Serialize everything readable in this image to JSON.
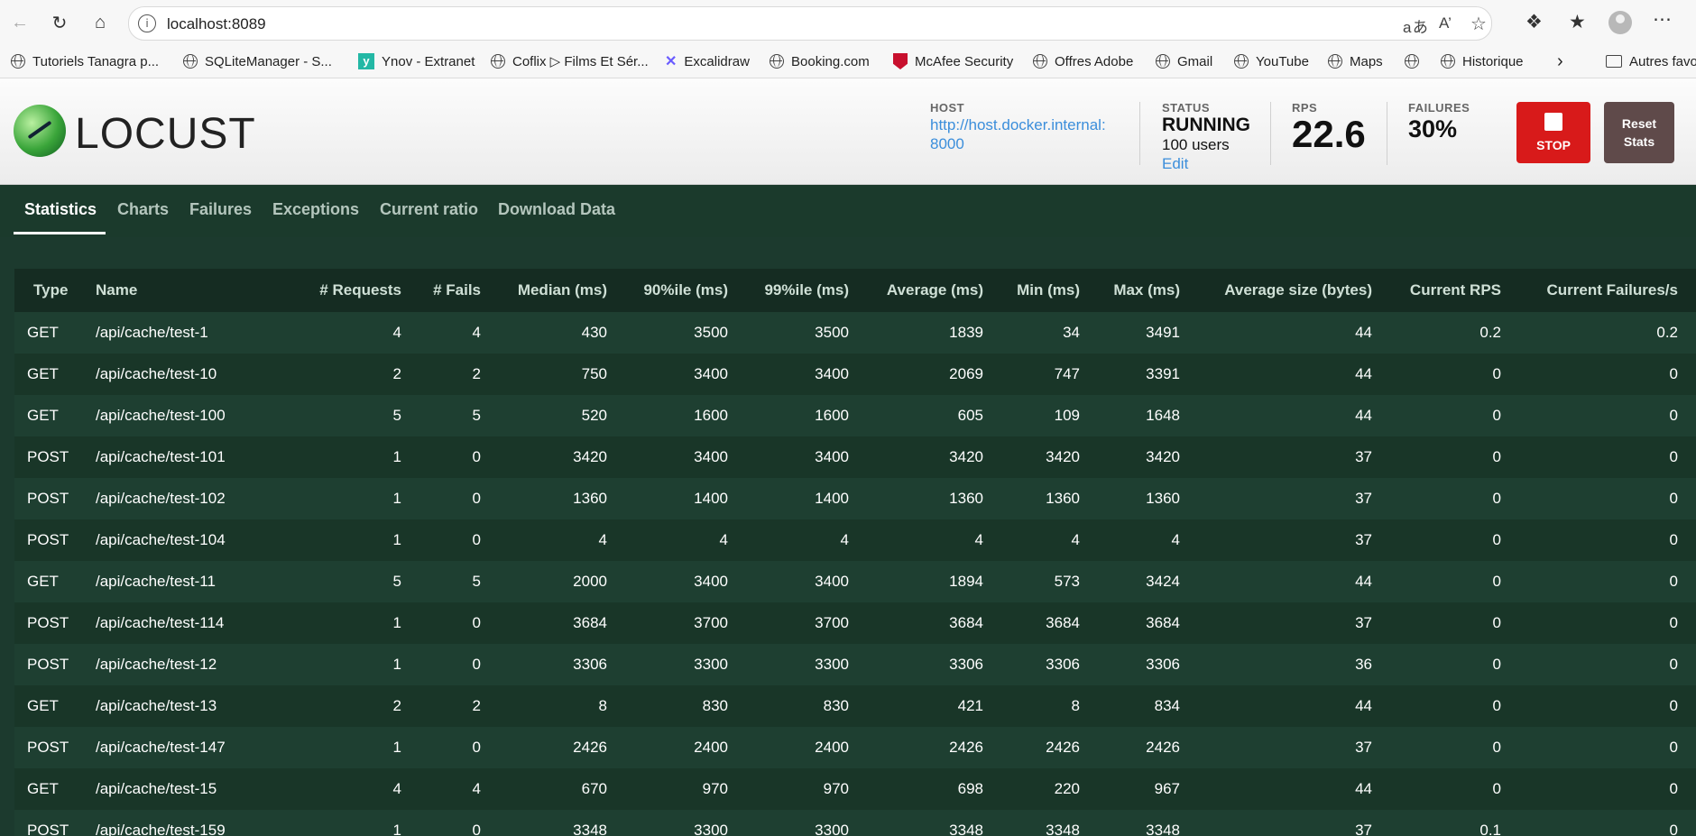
{
  "browser": {
    "url": "localhost:8089",
    "bookmarks": [
      {
        "label": "Tutoriels Tanagra p...",
        "icon": "globe-icon"
      },
      {
        "label": "SQLiteManager - S...",
        "icon": "globe-icon"
      },
      {
        "label": "Ynov - Extranet",
        "icon": "ynov-icon"
      },
      {
        "label": "Coflix ▷ Films Et Sér...",
        "icon": "globe-icon"
      },
      {
        "label": "Excalidraw",
        "icon": "excalidraw-icon"
      },
      {
        "label": "Booking.com",
        "icon": "globe-icon"
      },
      {
        "label": "McAfee Security",
        "icon": "mcafee-icon"
      },
      {
        "label": "Offres Adobe",
        "icon": "globe-icon"
      },
      {
        "label": "Gmail",
        "icon": "globe-icon"
      },
      {
        "label": "YouTube",
        "icon": "globe-icon"
      },
      {
        "label": "Maps",
        "icon": "globe-icon"
      },
      {
        "label": "",
        "icon": "globe-icon"
      },
      {
        "label": "Historique",
        "icon": "globe-icon"
      }
    ],
    "other_favorites": "Autres favo"
  },
  "header": {
    "logo_text": "LOCUST",
    "host_label": "HOST",
    "host_line1": "http://host.docker.internal:",
    "host_line2": "8000",
    "status_label": "STATUS",
    "status_value": "RUNNING",
    "users": "100 users",
    "edit": "Edit",
    "rps_label": "RPS",
    "rps_value": "22.6",
    "failures_label": "FAILURES",
    "failures_value": "30%",
    "stop_label": "STOP",
    "reset_line1": "Reset",
    "reset_line2": "Stats"
  },
  "tabs": [
    "Statistics",
    "Charts",
    "Failures",
    "Exceptions",
    "Current ratio",
    "Download Data"
  ],
  "table": {
    "columns": [
      "Type",
      "Name",
      "# Requests",
      "# Fails",
      "Median (ms)",
      "90%ile (ms)",
      "99%ile (ms)",
      "Average (ms)",
      "Min (ms)",
      "Max (ms)",
      "Average size (bytes)",
      "Current RPS",
      "Current Failures/s"
    ],
    "rows": [
      [
        "GET",
        "/api/cache/test-1",
        "4",
        "4",
        "430",
        "3500",
        "3500",
        "1839",
        "34",
        "3491",
        "44",
        "0.2",
        "0.2"
      ],
      [
        "GET",
        "/api/cache/test-10",
        "2",
        "2",
        "750",
        "3400",
        "3400",
        "2069",
        "747",
        "3391",
        "44",
        "0",
        "0"
      ],
      [
        "GET",
        "/api/cache/test-100",
        "5",
        "5",
        "520",
        "1600",
        "1600",
        "605",
        "109",
        "1648",
        "44",
        "0",
        "0"
      ],
      [
        "POST",
        "/api/cache/test-101",
        "1",
        "0",
        "3420",
        "3400",
        "3400",
        "3420",
        "3420",
        "3420",
        "37",
        "0",
        "0"
      ],
      [
        "POST",
        "/api/cache/test-102",
        "1",
        "0",
        "1360",
        "1400",
        "1400",
        "1360",
        "1360",
        "1360",
        "37",
        "0",
        "0"
      ],
      [
        "POST",
        "/api/cache/test-104",
        "1",
        "0",
        "4",
        "4",
        "4",
        "4",
        "4",
        "4",
        "37",
        "0",
        "0"
      ],
      [
        "GET",
        "/api/cache/test-11",
        "5",
        "5",
        "2000",
        "3400",
        "3400",
        "1894",
        "573",
        "3424",
        "44",
        "0",
        "0"
      ],
      [
        "POST",
        "/api/cache/test-114",
        "1",
        "0",
        "3684",
        "3700",
        "3700",
        "3684",
        "3684",
        "3684",
        "37",
        "0",
        "0"
      ],
      [
        "POST",
        "/api/cache/test-12",
        "1",
        "0",
        "3306",
        "3300",
        "3300",
        "3306",
        "3306",
        "3306",
        "36",
        "0",
        "0"
      ],
      [
        "GET",
        "/api/cache/test-13",
        "2",
        "2",
        "8",
        "830",
        "830",
        "421",
        "8",
        "834",
        "44",
        "0",
        "0"
      ],
      [
        "POST",
        "/api/cache/test-147",
        "1",
        "0",
        "2426",
        "2400",
        "2400",
        "2426",
        "2426",
        "2426",
        "37",
        "0",
        "0"
      ],
      [
        "GET",
        "/api/cache/test-15",
        "4",
        "4",
        "670",
        "970",
        "970",
        "698",
        "220",
        "967",
        "44",
        "0",
        "0"
      ],
      [
        "POST",
        "/api/cache/test-159",
        "1",
        "0",
        "3348",
        "3300",
        "3300",
        "3348",
        "3348",
        "3348",
        "37",
        "0.1",
        "0"
      ]
    ]
  }
}
